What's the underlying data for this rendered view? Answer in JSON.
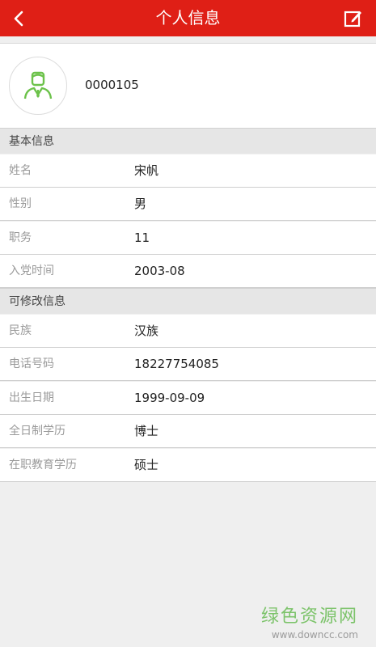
{
  "header": {
    "title": "个人信息",
    "back_icon": "chevron-left-icon",
    "edit_icon": "edit-icon"
  },
  "profile": {
    "user_id": "0000105",
    "avatar_icon": "user-avatar-icon"
  },
  "sections": {
    "basic": {
      "title": "基本信息",
      "rows": [
        {
          "label": "姓名",
          "value": "宋帆"
        },
        {
          "label": "性别",
          "value": "男"
        },
        {
          "label": "职务",
          "value": "11"
        },
        {
          "label": "入党时间",
          "value": "2003-08"
        }
      ]
    },
    "editable": {
      "title": "可修改信息",
      "rows": [
        {
          "label": "民族",
          "value": "汉族"
        },
        {
          "label": "电话号码",
          "value": "18227754085"
        },
        {
          "label": "出生日期",
          "value": "1999-09-09"
        },
        {
          "label": "全日制学历",
          "value": "博士"
        },
        {
          "label": "在职教育学历",
          "value": "硕士"
        }
      ]
    }
  },
  "watermark": {
    "main": "绿色资源网",
    "sub": "www.downcc.com"
  },
  "colors": {
    "header_bg": "#df1f16",
    "avatar_green": "#6cc24a"
  }
}
